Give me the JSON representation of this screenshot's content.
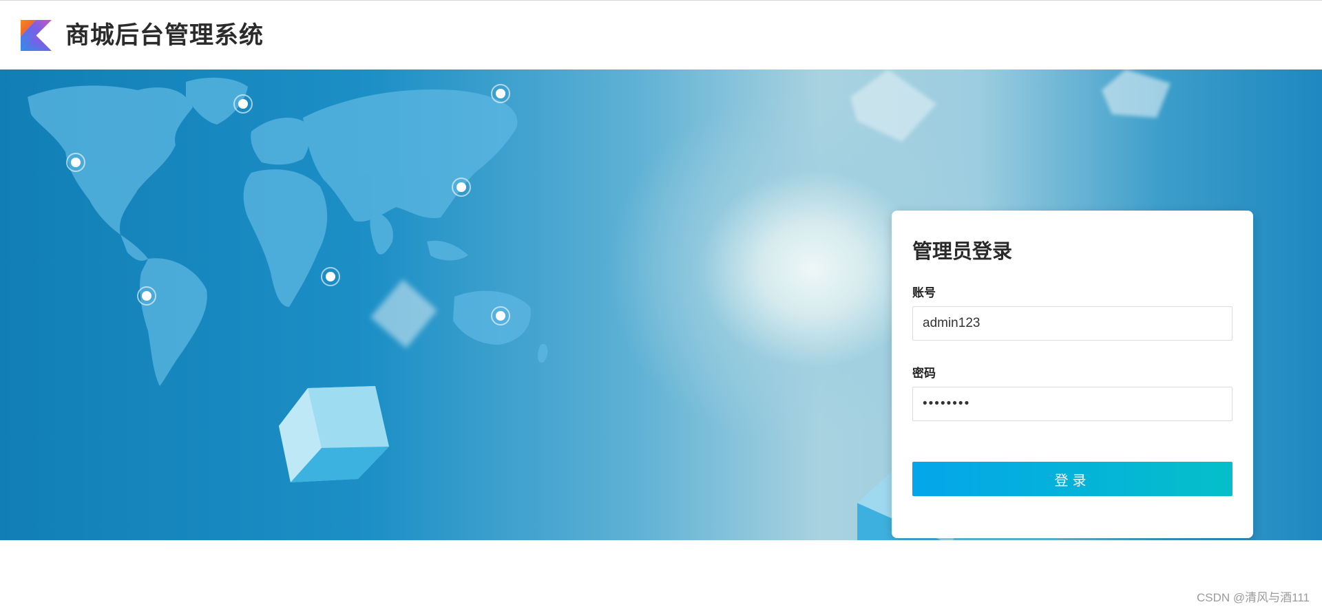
{
  "header": {
    "title": "商城后台管理系统",
    "logo_icon": "kotlin-k-logo-icon"
  },
  "login": {
    "title": "管理员登录",
    "account_label": "账号",
    "account_value": "admin123",
    "password_label": "密码",
    "password_value": "12345678",
    "submit_label": "登录"
  },
  "footer": {
    "watermark": "CSDN @清风与酒111"
  },
  "colors": {
    "button_start": "#04a6ea",
    "button_end": "#05bfc9",
    "banner_blue": "#117fb6"
  }
}
